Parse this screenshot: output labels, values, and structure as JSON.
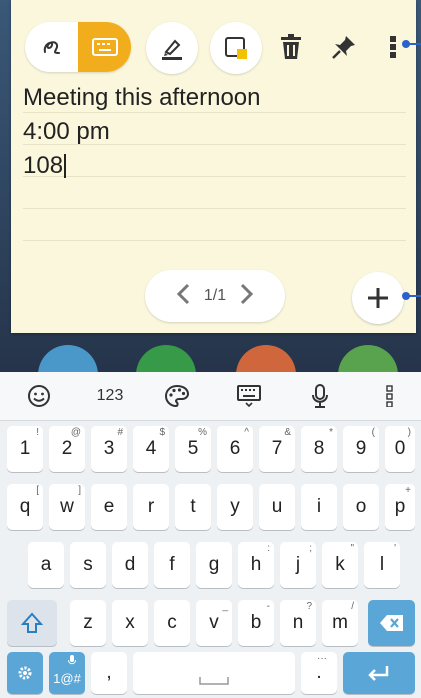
{
  "note": {
    "lines": [
      "Meeting this afternoon",
      "4:00 pm",
      "108"
    ],
    "page_indicator": "1/1"
  },
  "toolbar": {
    "icons": [
      "handwriting-icon",
      "keyboard-icon",
      "highlighter-icon",
      "note-color-icon",
      "trash-icon",
      "pin-icon",
      "more-vert-icon"
    ],
    "accent": "#f2ad1d"
  },
  "keyboard": {
    "suggestion_bar": {
      "emoji_icon": "smiley-icon",
      "numbers_label": "123",
      "theme_icon": "palette-icon",
      "layout_icon": "keyboard-icon",
      "voice_icon": "mic-icon",
      "more_icon": "more-vert-icon"
    },
    "number_row": [
      {
        "main": "1",
        "hint": "!"
      },
      {
        "main": "2",
        "hint": "@"
      },
      {
        "main": "3",
        "hint": "#"
      },
      {
        "main": "4",
        "hint": "$"
      },
      {
        "main": "5",
        "hint": "%"
      },
      {
        "main": "6",
        "hint": "^"
      },
      {
        "main": "7",
        "hint": "&"
      },
      {
        "main": "8",
        "hint": "*"
      },
      {
        "main": "9",
        "hint": "("
      },
      {
        "main": "0",
        "hint": ")"
      }
    ],
    "row1": [
      {
        "main": "q",
        "hint": "["
      },
      {
        "main": "w",
        "hint": "]"
      },
      {
        "main": "e",
        "hint": ""
      },
      {
        "main": "r",
        "hint": ""
      },
      {
        "main": "t",
        "hint": ""
      },
      {
        "main": "y",
        "hint": ""
      },
      {
        "main": "u",
        "hint": ""
      },
      {
        "main": "i",
        "hint": ""
      },
      {
        "main": "o",
        "hint": ""
      },
      {
        "main": "p",
        "hint": "+"
      }
    ],
    "row2": [
      {
        "main": "a",
        "hint": ""
      },
      {
        "main": "s",
        "hint": ""
      },
      {
        "main": "d",
        "hint": ""
      },
      {
        "main": "f",
        "hint": ""
      },
      {
        "main": "g",
        "hint": ""
      },
      {
        "main": "h",
        "hint": ":"
      },
      {
        "main": "j",
        "hint": ";"
      },
      {
        "main": "k",
        "hint": "\""
      },
      {
        "main": "l",
        "hint": "'"
      }
    ],
    "row3": [
      {
        "main": "z",
        "hint": ""
      },
      {
        "main": "x",
        "hint": ""
      },
      {
        "main": "c",
        "hint": ""
      },
      {
        "main": "v",
        "hint": "_"
      },
      {
        "main": "b",
        "hint": "-"
      },
      {
        "main": "n",
        "hint": "?"
      },
      {
        "main": "m",
        "hint": "/"
      }
    ],
    "bottom": {
      "symbols_label": "1@#",
      "comma_label": ",",
      "period_label": "."
    },
    "key_accent": "#5aa6d6"
  }
}
